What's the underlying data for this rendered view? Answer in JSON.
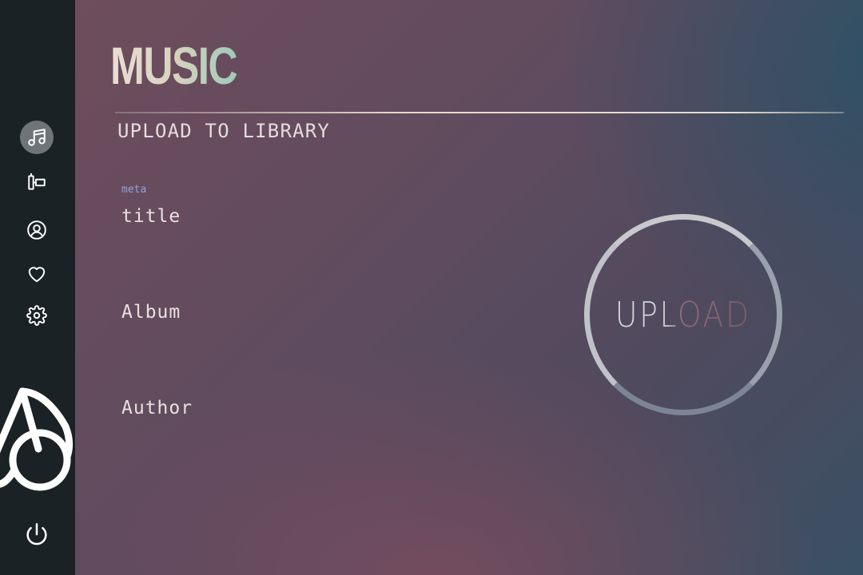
{
  "app": {
    "title": "MUSIC"
  },
  "page": {
    "title": "UPLOAD TO LIBRARY"
  },
  "sidebar": {
    "items": [
      {
        "name": "music",
        "icon": "music-note-icon",
        "active": true
      },
      {
        "name": "library",
        "icon": "library-icon",
        "active": false
      },
      {
        "name": "profile",
        "icon": "user-circle-icon",
        "active": false
      },
      {
        "name": "favorites",
        "icon": "heart-icon",
        "active": false
      },
      {
        "name": "settings",
        "icon": "gear-icon",
        "active": false
      }
    ],
    "logo_icon": "app-logo-icon",
    "power_icon": "power-icon"
  },
  "form": {
    "title_meta": "meta",
    "title_label": "title",
    "album_label": "Album",
    "author_label": "Author"
  },
  "upload": {
    "label": "UPLOAD"
  },
  "colors": {
    "sidebar_bg": "#1b2226",
    "active_nav_bg": "#6f7478",
    "meta_accent": "#8fa4d8",
    "text_light": "#e9e0e0"
  }
}
